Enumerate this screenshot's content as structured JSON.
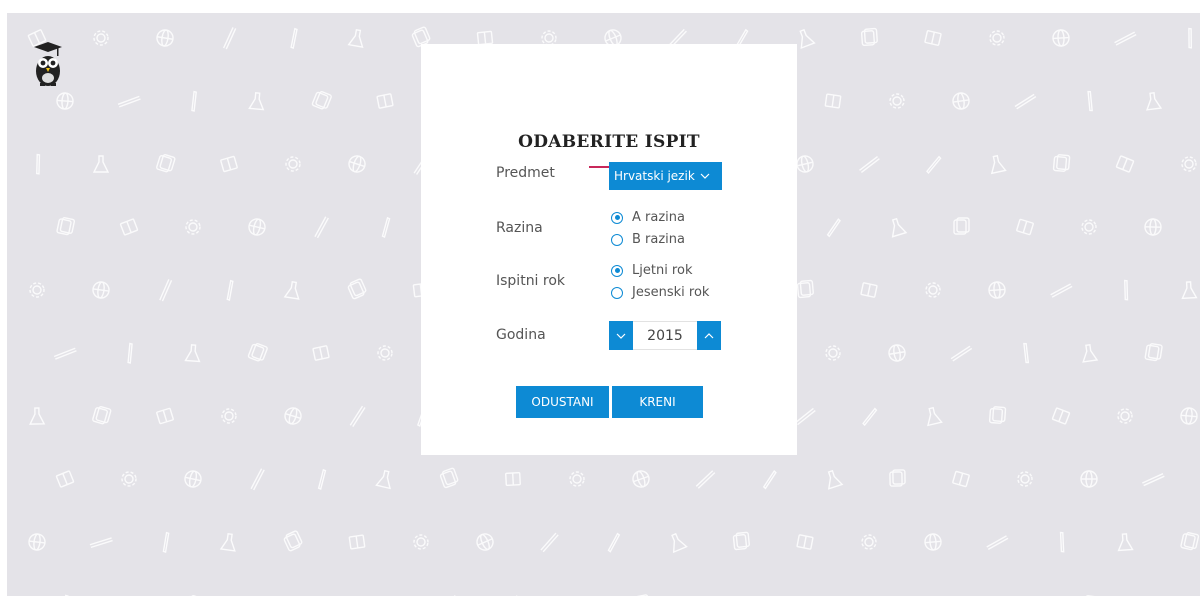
{
  "page": {
    "brand_icon": "owl-graduate-logo-icon",
    "background_pattern_icons": [
      "book-icon",
      "gear-icon",
      "globe-icon",
      "pencil-icon",
      "pen-icon",
      "flask-icon",
      "books-stack-icon"
    ]
  },
  "dialog": {
    "title": "ODABERITE ISPIT",
    "fields": {
      "subject": {
        "label": "Predmet",
        "selected": "Hrvatski jezik"
      },
      "level": {
        "label": "Razina",
        "options": [
          {
            "label": "A razina",
            "checked": true
          },
          {
            "label": "B razina",
            "checked": false
          }
        ]
      },
      "term": {
        "label": "Ispitni rok",
        "options": [
          {
            "label": "Ljetni rok",
            "checked": true
          },
          {
            "label": "Jesenski rok",
            "checked": false
          }
        ]
      },
      "year": {
        "label": "Godina",
        "value": "2015"
      }
    },
    "buttons": {
      "cancel": "ODUSTANI",
      "go": "KRENI"
    }
  },
  "colors": {
    "accent": "#0d8ad4",
    "title_rule": "#c8285a",
    "background": "#e4e3e8"
  }
}
